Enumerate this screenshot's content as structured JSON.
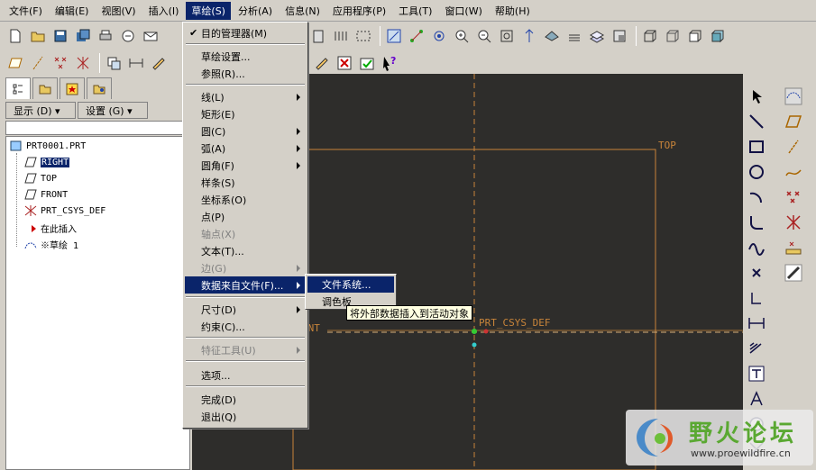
{
  "menubar": {
    "items": [
      {
        "label": "文件(F)"
      },
      {
        "label": "编辑(E)"
      },
      {
        "label": "视图(V)"
      },
      {
        "label": "插入(I)"
      },
      {
        "label": "草绘(S)"
      },
      {
        "label": "分析(A)"
      },
      {
        "label": "信息(N)"
      },
      {
        "label": "应用程序(P)"
      },
      {
        "label": "工具(T)"
      },
      {
        "label": "窗口(W)"
      },
      {
        "label": "帮助(H)"
      }
    ],
    "active_index": 4
  },
  "panel": {
    "show_label": "显示 (D) ▾",
    "settings_label": "设置 (G) ▾"
  },
  "tree": {
    "root": "PRT0001.PRT",
    "items": [
      {
        "label": "RIGHT",
        "icon": "datum-plane-icon",
        "selected": true
      },
      {
        "label": "TOP",
        "icon": "datum-plane-icon"
      },
      {
        "label": "FRONT",
        "icon": "datum-plane-icon"
      },
      {
        "label": "PRT_CSYS_DEF",
        "icon": "csys-icon"
      },
      {
        "label": "在此插入",
        "icon": "insert-arrow-icon"
      },
      {
        "label": "※草绘 1",
        "icon": "sketch-icon"
      }
    ]
  },
  "sketch_menu": {
    "items": [
      {
        "label": "目的管理器(M)",
        "checked": true
      },
      {
        "label": "草绘设置..."
      },
      {
        "label": "参照(R)..."
      },
      {
        "label": "线(L)",
        "submenu": true
      },
      {
        "label": "矩形(E)"
      },
      {
        "label": "圆(C)",
        "submenu": true
      },
      {
        "label": "弧(A)",
        "submenu": true
      },
      {
        "label": "圆角(F)",
        "submenu": true
      },
      {
        "label": "样条(S)"
      },
      {
        "label": "坐标系(O)"
      },
      {
        "label": "点(P)"
      },
      {
        "label": "轴点(X)",
        "disabled": true
      },
      {
        "label": "文本(T)..."
      },
      {
        "label": "边(G)",
        "disabled": true,
        "submenu": true
      },
      {
        "label": "数据来自文件(F)...",
        "submenu": true,
        "highlighted": true
      },
      {
        "label": "尺寸(D)",
        "submenu": true
      },
      {
        "label": "约束(C)..."
      },
      {
        "label": "特征工具(U)",
        "disabled": true,
        "submenu": true
      },
      {
        "label": "选项..."
      },
      {
        "label": "完成(D)"
      },
      {
        "label": "退出(Q)"
      }
    ]
  },
  "submenu": {
    "items": [
      {
        "label": "文件系统...",
        "highlighted": true
      },
      {
        "label": "调色板"
      }
    ]
  },
  "tooltip": "将外部数据插入到活动对象",
  "canvas": {
    "labels": {
      "top": "TOP",
      "front": "ONT",
      "csys": "PRT_CSYS_DEF"
    },
    "bg_color": "#2e2d2b",
    "datum_color": "#c8843a"
  },
  "watermark": {
    "title": "野火论坛",
    "url": "www.proewildfire.cn"
  }
}
